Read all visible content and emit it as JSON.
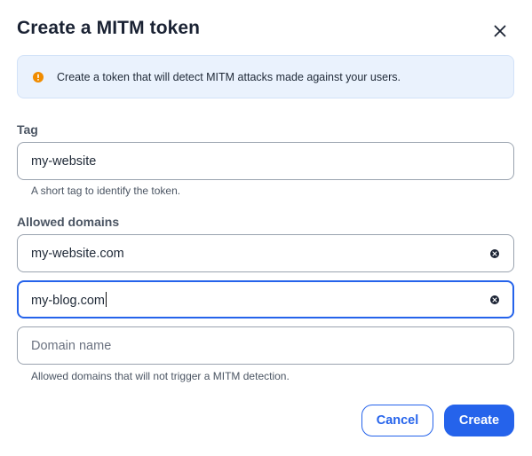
{
  "dialog": {
    "title": "Create a MITM token",
    "close_icon": "close-icon"
  },
  "info": {
    "icon": "warning-circle-icon",
    "icon_color": "#f08c00",
    "text": "Create a token that will detect MITM attacks made against your users."
  },
  "tag": {
    "label": "Tag",
    "value": "my-website",
    "help": "A short tag to identify the token."
  },
  "domains": {
    "label": "Allowed domains",
    "items": [
      {
        "value": "my-website.com",
        "clear_icon": "clear-icon"
      },
      {
        "value": "my-blog.com",
        "clear_icon": "clear-icon",
        "focused": true
      }
    ],
    "new_placeholder": "Domain name",
    "help": "Allowed domains that will not trigger a MITM detection."
  },
  "actions": {
    "cancel_label": "Cancel",
    "create_label": "Create"
  },
  "colors": {
    "accent": "#2563eb",
    "info_bg": "#eaf2fd"
  }
}
